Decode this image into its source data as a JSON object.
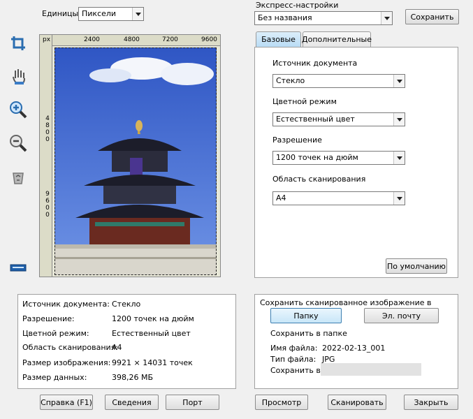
{
  "units": {
    "label": "Единицы",
    "value": "Пиксели"
  },
  "preset": {
    "label": "Экспресс-настройки",
    "value": "Без названия",
    "save_button": "Сохранить"
  },
  "ruler": {
    "unit": "px",
    "h_ticks": [
      "2400",
      "4800",
      "7200",
      "9600"
    ],
    "v_ticks": [
      "4800",
      "9600"
    ]
  },
  "tabs": [
    "Базовые",
    "Дополнительные"
  ],
  "basic": {
    "source_label": "Источник документа",
    "source_value": "Стекло",
    "color_label": "Цветной режим",
    "color_value": "Естественный цвет",
    "resolution_label": "Разрешение",
    "resolution_value": "1200 точек на дюйм",
    "area_label": "Область сканирования",
    "area_value": "A4",
    "default_button": "По умолчанию"
  },
  "info": {
    "rows": [
      {
        "label": "Источник документа:",
        "value": "Стекло"
      },
      {
        "label": "Разрешение:",
        "value": "1200 точек на дюйм"
      },
      {
        "label": "Цветной режим:",
        "value": "Естественный цвет"
      },
      {
        "label": "Область сканирования:",
        "value": "A4"
      },
      {
        "label": "Размер изображения:",
        "value": "9921 × 14031  точек"
      },
      {
        "label": "Размер данных:",
        "value": "398,26 МБ"
      }
    ]
  },
  "save": {
    "title": "Сохранить сканированное изображение в",
    "folder_button": "Папку",
    "email_button": "Эл. почту",
    "folder_heading": "Сохранить в папке",
    "filename_label": "Имя файла:",
    "filename_value": "2022-02-13_001",
    "filetype_label": "Тип файла:",
    "filetype_value": "JPG",
    "saveto_label": "Сохранить в:"
  },
  "footer": {
    "help": "Справка (F1)",
    "about": "Сведения",
    "port": "Порт",
    "preview": "Просмотр",
    "scan": "Сканировать",
    "close": "Закрыть"
  },
  "colors": {
    "accent": "#3c7fb1",
    "tab_active": "#b9dcf5",
    "sky": "#3f64d2",
    "tool_icon": "#2a6db0"
  }
}
